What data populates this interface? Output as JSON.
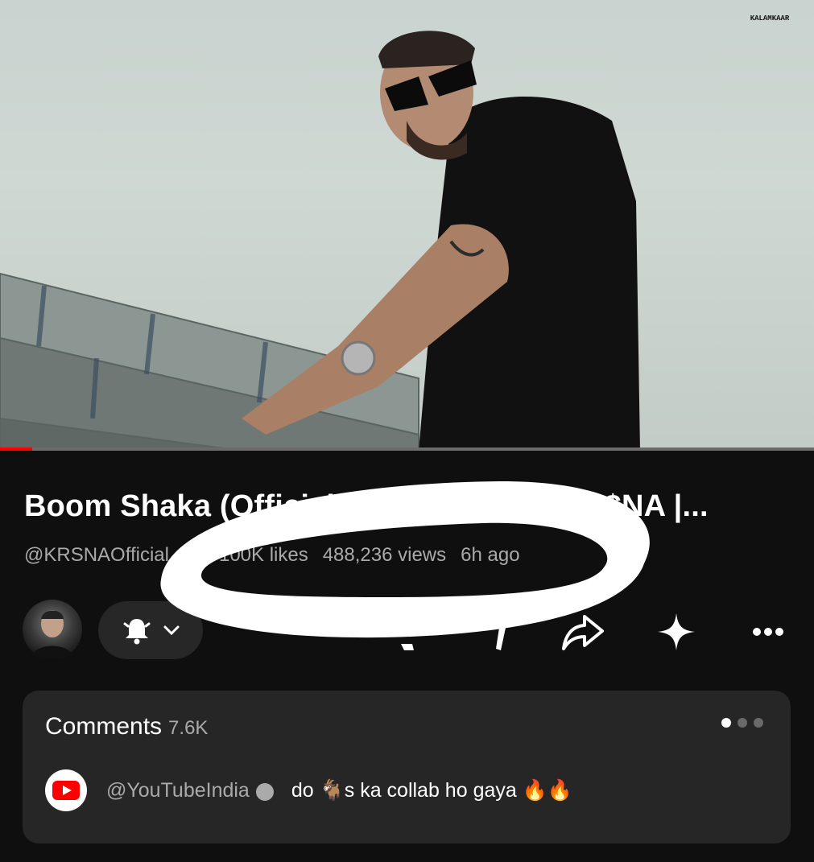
{
  "video": {
    "watermark": "KALAMKAAR",
    "progress_fraction": 0.04
  },
  "details": {
    "title": "Boom Shaka (Official Music Video) | KR$NA |...",
    "channel_handle": "@KRSNAOfficial",
    "likes": "100K likes",
    "views": "488,236 views",
    "age": "6h ago"
  },
  "actions": {
    "bell_icon": "bell-icon",
    "share_icon": "share-icon",
    "sparkle_icon": "sparkle-icon",
    "more_icon": "more-icon"
  },
  "comments": {
    "label": "Comments",
    "count": "7.6K",
    "top_comment": {
      "author": "@YouTubeIndia",
      "text_before": "do",
      "emoji_goat": "🐐",
      "text_after": "s ka collab ho gaya",
      "emoji_fire": "🔥🔥"
    }
  },
  "colors": {
    "background": "#0f0f0f",
    "card": "#262626",
    "muted_text": "#aaaaaa",
    "accent": "#ff0000"
  }
}
